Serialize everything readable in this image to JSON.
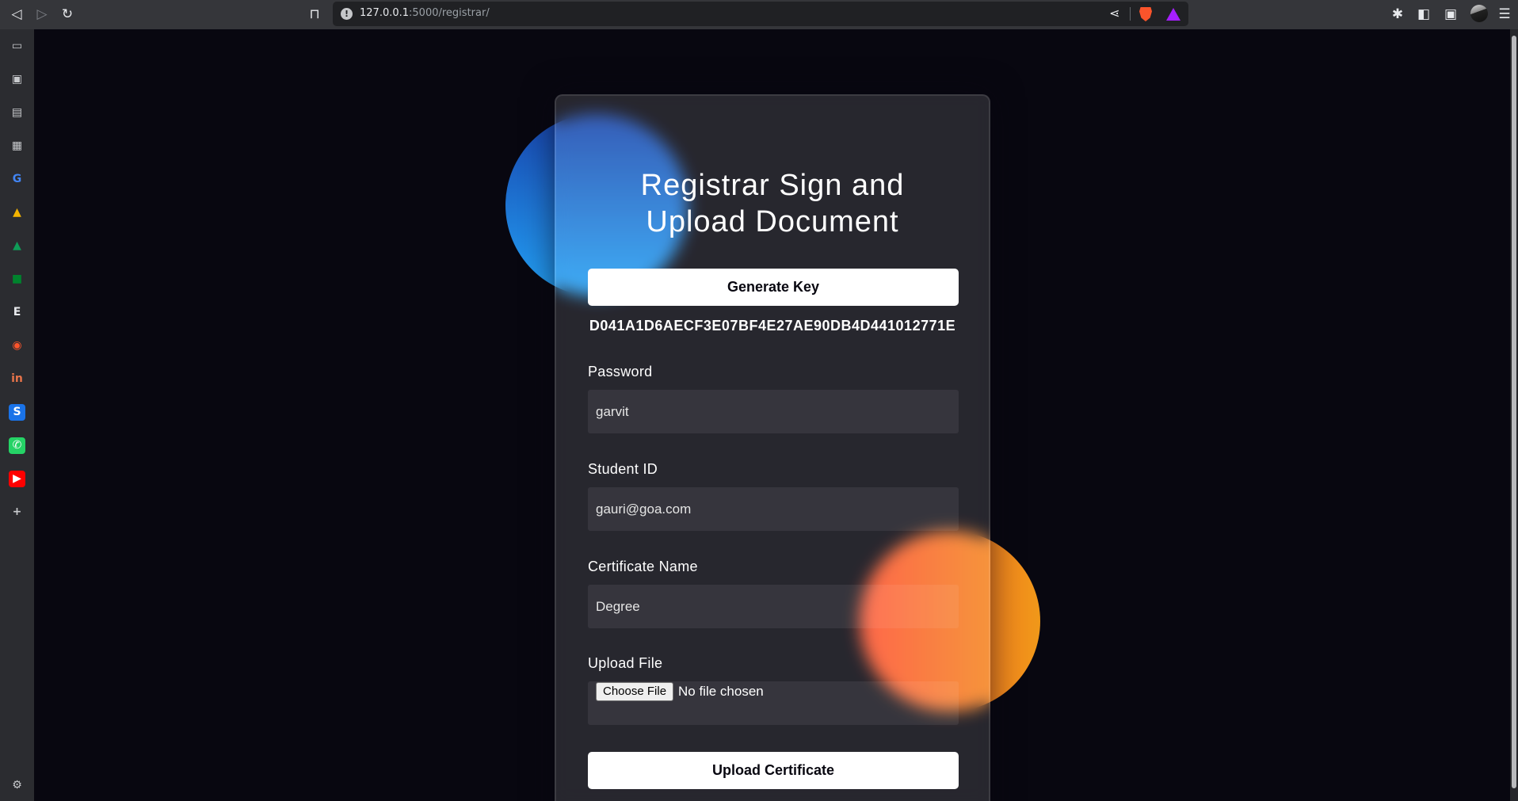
{
  "browser": {
    "url_host": "127.0.0.1",
    "url_rest": ":5000/registrar/"
  },
  "sidebar": {
    "items": [
      {
        "name": "video-icon",
        "glyph": "▭"
      },
      {
        "name": "wallet-icon",
        "glyph": "▣"
      },
      {
        "name": "bookmarks-icon",
        "glyph": "▤"
      },
      {
        "name": "reading-list-icon",
        "glyph": "▦"
      },
      {
        "name": "google-icon",
        "glyph": "G",
        "color": "#4285f4"
      },
      {
        "name": "photos-icon",
        "glyph": "▲",
        "color": "#f4b400"
      },
      {
        "name": "drive-icon",
        "glyph": "▲",
        "color": "#0f9d58"
      },
      {
        "name": "meet-icon",
        "glyph": "■",
        "color": "#00832d"
      },
      {
        "name": "e-icon",
        "glyph": "E",
        "color": "#e8eaed"
      },
      {
        "name": "brave-talk-icon",
        "glyph": "◉",
        "color": "#fb542b"
      },
      {
        "name": "in-icon",
        "glyph": "in",
        "color": "#e8744a"
      },
      {
        "name": "s-icon",
        "glyph": "S",
        "color": "#ffffff",
        "bg": "#1a73e8"
      },
      {
        "name": "whatsapp-icon",
        "glyph": "✆",
        "color": "#ffffff",
        "bg": "#25d366"
      },
      {
        "name": "youtube-icon",
        "glyph": "▶",
        "color": "#ffffff",
        "bg": "#ff0000"
      },
      {
        "name": "add-icon",
        "glyph": "+"
      }
    ]
  },
  "form": {
    "title_line1": "Registrar Sign and",
    "title_line2": "Upload Document",
    "generate_label": "Generate Key",
    "key_value": "D041A1D6AECF3E07BF4E27AE90DB4D441012771E",
    "password_label": "Password",
    "password_value": "garvit",
    "student_label": "Student ID",
    "student_value": "gauri@goa.com",
    "cert_label": "Certificate Name",
    "cert_value": "Degree",
    "upload_label": "Upload File",
    "choose_file_label": "Choose File",
    "no_file_text": "No file chosen",
    "submit_label": "Upload Certificate"
  }
}
